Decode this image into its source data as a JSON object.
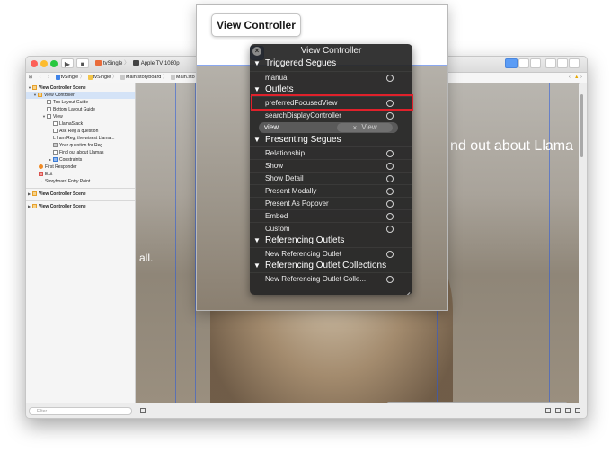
{
  "toolbar": {
    "scheme_target": "tvSingle",
    "scheme_device": "Apple TV 1080p"
  },
  "jumpbar": {
    "items": [
      "tvSingle",
      "tvSingle",
      "Main.storyboard",
      "Main.sto"
    ]
  },
  "outline": {
    "items": [
      {
        "label": "View Controller Scene",
        "bold": true
      },
      {
        "label": "View Controller"
      },
      {
        "label": "Top Layout Guide"
      },
      {
        "label": "Bottom Layout Guide"
      },
      {
        "label": "View"
      },
      {
        "label": "LlamaStack"
      },
      {
        "label": "Ask Reg a question"
      },
      {
        "label": "L  I am Reg, the wisest Llama..."
      },
      {
        "label": "Your question for Reg"
      },
      {
        "label": "Find out about Llamas"
      },
      {
        "label": "Constraints"
      },
      {
        "label": "First Responder"
      },
      {
        "label": "Exit"
      },
      {
        "label": "Storyboard Entry Point"
      },
      {
        "label": "View Controller Scene",
        "bold": true
      },
      {
        "label": "View Controller Scene",
        "bold": true
      }
    ],
    "filter_placeholder": "Filter"
  },
  "canvas": {
    "text_right": "nd out about Llama",
    "text_left": "all."
  },
  "bubble": {
    "title": "View Controller"
  },
  "hud": {
    "title": "View Controller",
    "sections": {
      "triggered": "Triggered Segues",
      "outlets": "Outlets",
      "presenting": "Presenting Segues",
      "referencing": "Referencing Outlets",
      "collections": "Referencing Outlet Collections"
    },
    "triggered_items": [
      "manual"
    ],
    "outlet_items": [
      "preferredFocusedView",
      "searchDisplayController"
    ],
    "view_outlet": {
      "name": "view",
      "target": "View"
    },
    "presenting_items": [
      "Relationship",
      "Show",
      "Show Detail",
      "Present Modally",
      "Present As Popover",
      "Embed",
      "Custom"
    ],
    "referencing_items": [
      "New Referencing Outlet"
    ],
    "collection_items": [
      "New Referencing Outlet Colle..."
    ]
  },
  "colors": {
    "highlight": "#e0212b",
    "hud_background": "#262626",
    "selection": "#d4e3f7"
  }
}
